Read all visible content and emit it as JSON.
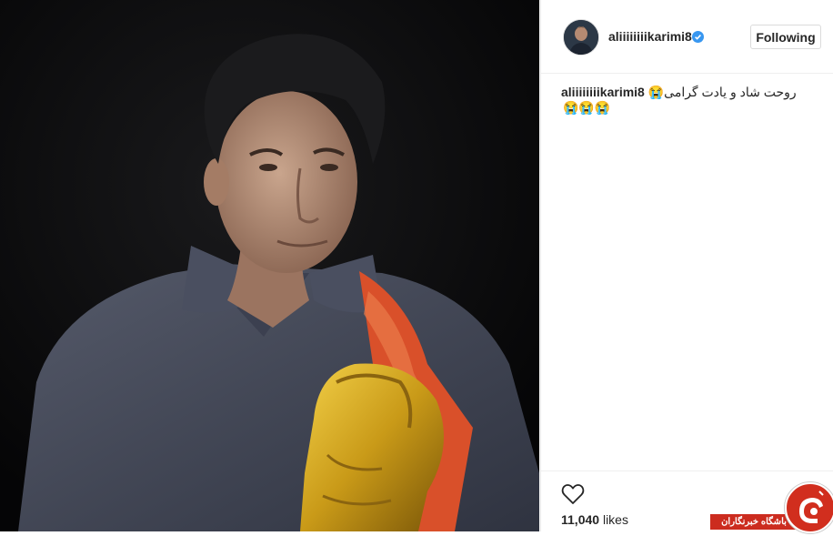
{
  "post": {
    "username": "aliiiiiiiikarimi8",
    "follow_label": "Following",
    "caption_username": "aliiiiiiiikarimi8",
    "caption_text": "روحت شاد و یادت گرامی😭😭😭😭",
    "likes_count": "11,040",
    "likes_label": "likes"
  },
  "watermark": {
    "text": "باشگاه خبرنگاران"
  },
  "colors": {
    "verified": "#3897f0",
    "watermark": "#cc2c1f"
  }
}
